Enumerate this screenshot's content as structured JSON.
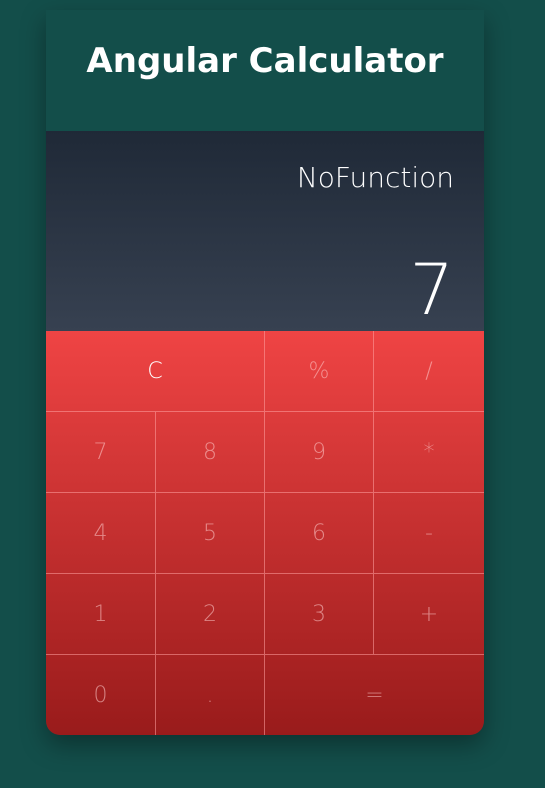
{
  "header": {
    "title": "Angular Calculator"
  },
  "display": {
    "operation": "NoFunction",
    "value": "7"
  },
  "keys": {
    "clear": "C",
    "percent": "%",
    "divide": "/",
    "seven": "7",
    "eight": "8",
    "nine": "9",
    "multiply": "*",
    "four": "4",
    "five": "5",
    "six": "6",
    "minus": "-",
    "one": "1",
    "two": "2",
    "three": "3",
    "plus": "+",
    "zero": "0",
    "dot": ".",
    "equals": "="
  },
  "colors": {
    "page_background": "#134e4a",
    "display_top": "#1f2937",
    "display_bottom": "#374151",
    "keys_top": "#ef4444",
    "keys_bottom": "#991b1b"
  }
}
